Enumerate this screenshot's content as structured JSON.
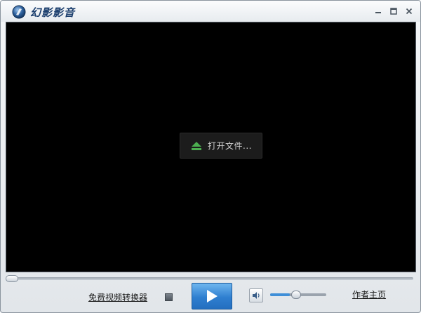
{
  "window": {
    "title": "幻影影音",
    "controls": [
      "minimize-icon",
      "maximize-icon",
      "close-icon"
    ]
  },
  "video": {
    "open_file_label": "打开文件...",
    "open_file_icon": "eject-icon",
    "background": "#000000"
  },
  "seek": {
    "progress": 0
  },
  "controls": {
    "converter_link": "免费视频转换器",
    "stop_icon": "stop-icon",
    "play_icon": "play-icon",
    "volume_icon": "speaker-icon",
    "volume_level": 0.35,
    "author_link": "作者主页"
  },
  "colors": {
    "accent": "#2f7fd0",
    "open_icon": "#4caf50",
    "title_text": "#1c3f6e"
  }
}
